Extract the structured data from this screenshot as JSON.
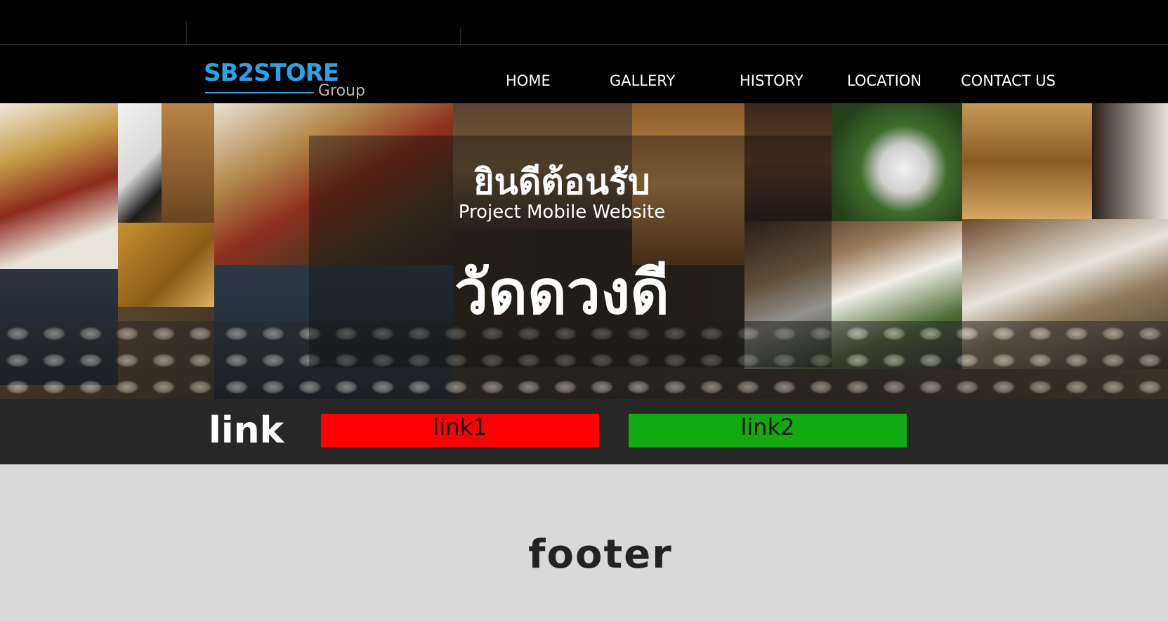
{
  "colors": {
    "brand_blue": "#2aa3e6",
    "header_bg": "#000000",
    "link1_bg": "#ff0000",
    "link2_bg": "#11aa11",
    "linkbar_bg": "#272727",
    "footer_bg": "#d9d9d9"
  },
  "logo": {
    "main": "SB2STORE",
    "sub": "Group"
  },
  "nav": [
    {
      "label": "HOME"
    },
    {
      "label": "GALLERY"
    },
    {
      "label": "HISTORY"
    },
    {
      "label": "LOCATION"
    },
    {
      "label": "CONTACT US"
    }
  ],
  "banner": {
    "welcome_th": "ยินดีต้อนรับ",
    "welcome_en": "Project Mobile Website",
    "temple_name": "วัดดวงดี"
  },
  "links": {
    "title": "link",
    "items": [
      {
        "label": "link1"
      },
      {
        "label": "link2"
      }
    ]
  },
  "footer": {
    "text": "footer"
  }
}
